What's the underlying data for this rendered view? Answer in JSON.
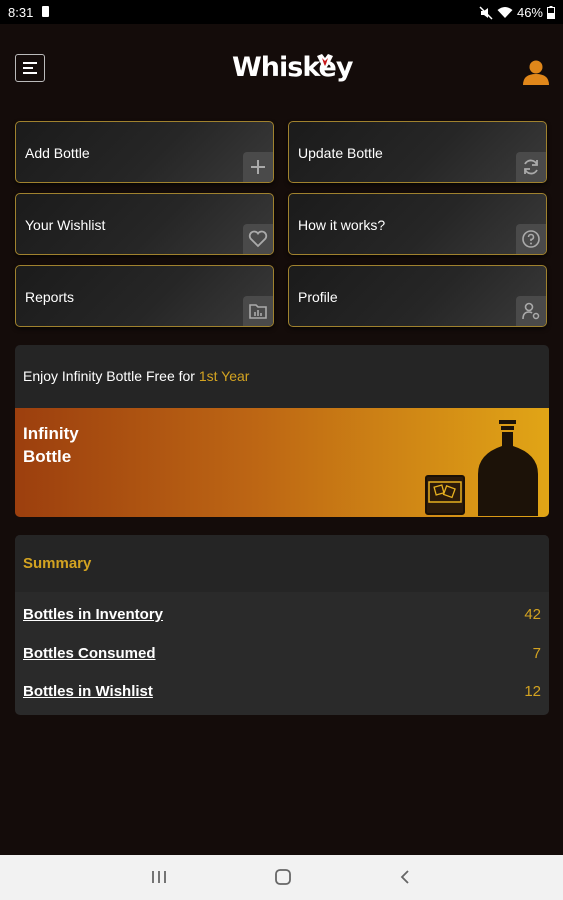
{
  "status_bar": {
    "time": "8:31",
    "battery": "46%"
  },
  "header": {
    "logo_text": "Whiskey",
    "menu_icon": "hamburger-menu-icon",
    "profile_icon": "user-icon",
    "accent_color": "#e0871a"
  },
  "tiles": [
    {
      "label": "Add Bottle",
      "icon": "plus-icon"
    },
    {
      "label": "Update Bottle",
      "icon": "refresh-icon"
    },
    {
      "label": "Your Wishlist",
      "icon": "heart-icon"
    },
    {
      "label": "How it works?",
      "icon": "question-icon"
    },
    {
      "label": "Reports",
      "icon": "chart-folder-icon"
    },
    {
      "label": "Profile",
      "icon": "user-settings-icon"
    }
  ],
  "promo": {
    "text": "Enjoy Infinity Bottle Free for ",
    "highlight": "1st Year",
    "banner_line1": "Infinity",
    "banner_line2": "Bottle",
    "highlight_color": "#d3a321"
  },
  "summary": {
    "title": "Summary",
    "rows": [
      {
        "label": "Bottles in Inventory",
        "value": "42"
      },
      {
        "label": "Bottles Consumed",
        "value": "7"
      },
      {
        "label": "Bottles in Wishlist",
        "value": "12"
      }
    ]
  },
  "nav": {
    "recent_icon": "recent-apps-icon",
    "home_icon": "home-icon",
    "back_icon": "back-icon"
  }
}
